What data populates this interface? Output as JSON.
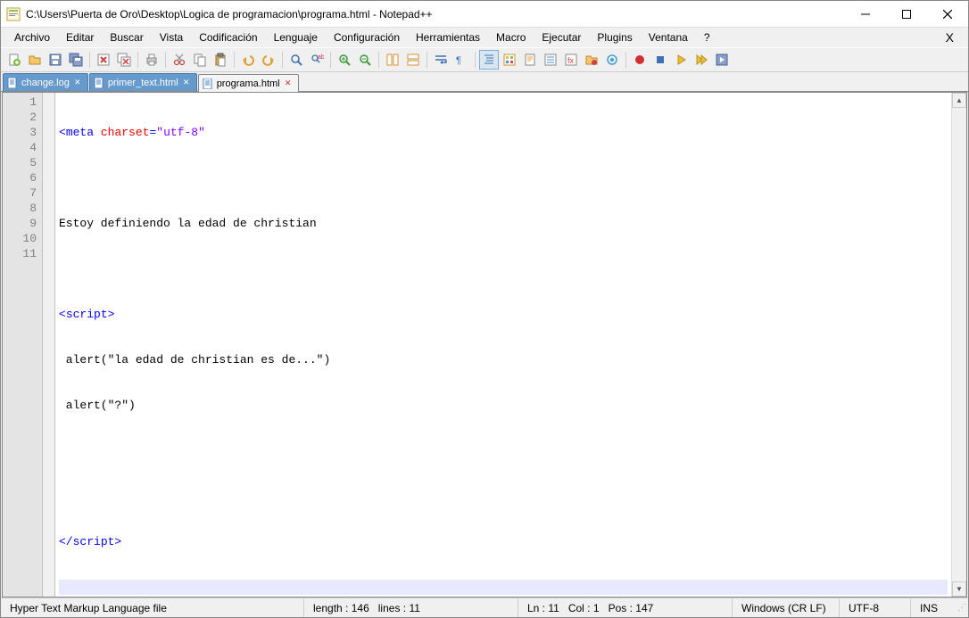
{
  "title": "C:\\Users\\Puerta de Oro\\Desktop\\Logica de programacion\\programa.html - Notepad++",
  "menu": [
    "Archivo",
    "Editar",
    "Buscar",
    "Vista",
    "Codificación",
    "Lenguaje",
    "Configuración",
    "Herramientas",
    "Macro",
    "Ejecutar",
    "Plugins",
    "Ventana",
    "?"
  ],
  "tabs": [
    {
      "label": "change.log",
      "active": false
    },
    {
      "label": "primer_text.html",
      "active": false
    },
    {
      "label": "programa.html",
      "active": true
    }
  ],
  "code_lines": [
    {
      "n": "1",
      "type": "tag",
      "raw": "<meta charset=\"utf-8\""
    },
    {
      "n": "2",
      "type": "blank"
    },
    {
      "n": "3",
      "type": "text",
      "raw": "Estoy definiendo la edad de christian"
    },
    {
      "n": "4",
      "type": "blank"
    },
    {
      "n": "5",
      "type": "open",
      "raw": "<script>"
    },
    {
      "n": "6",
      "type": "js",
      "raw": " alert(\"la edad de christian es de...\")"
    },
    {
      "n": "7",
      "type": "js",
      "raw": " alert(\"?\")"
    },
    {
      "n": "8",
      "type": "blank"
    },
    {
      "n": "9",
      "type": "blank"
    },
    {
      "n": "10",
      "type": "close",
      "raw": "</"
    },
    {
      "n": "11",
      "type": "current"
    }
  ],
  "meta_tag_parts": {
    "open": "<",
    "name": "meta",
    "sp": " ",
    "attr": "charset",
    "eq": "=",
    "q": "\"",
    "val": "utf-8",
    "q2": "\""
  },
  "script_open_parts": {
    "open": "<",
    "name": "script",
    "close": ">"
  },
  "script_close_parts": {
    "open": "</",
    "name": "script",
    "close": ">"
  },
  "text_line": "Estoy definiendo la edad de christian",
  "js_line_6": " alert(\"la edad de christian es de...\")",
  "js_line_7": " alert(\"?\")",
  "status": {
    "filetype": "Hyper Text Markup Language file",
    "length_label": "length :",
    "length": "146",
    "lines_label": "lines :",
    "lines": "11",
    "ln_label": "Ln :",
    "ln": "11",
    "col_label": "Col :",
    "col": "1",
    "pos_label": "Pos :",
    "pos": "147",
    "eol": "Windows (CR LF)",
    "encoding": "UTF-8",
    "ins": "INS"
  }
}
